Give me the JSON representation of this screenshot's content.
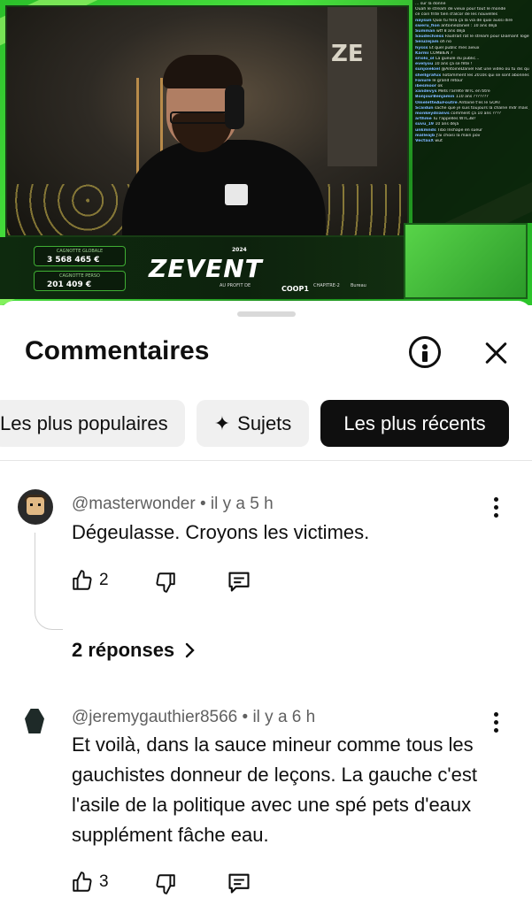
{
  "video": {
    "chat_messages": [
      {
        "user": "",
        "text": "... sur la donne"
      },
      {
        "user": "",
        "text": "Ouah le stream de vieux pour tout le monde"
      },
      {
        "user": "",
        "text": "ce coin frite tien d'alcor de les nouvelles"
      },
      {
        "user": "naysun",
        "text": "Quoi tu fera ça la via de quoi aussi dire"
      },
      {
        "user": "sweru_fion",
        "text": "antoineDaniel : 10 ans déjà"
      },
      {
        "user": "Summan",
        "text": "wtf 8 ans déjà"
      },
      {
        "user": "Saudechiess",
        "text": "Faudrait rat le stream pour Diamant Together"
      },
      {
        "user": "Seiuzejam",
        "text": "oh no"
      },
      {
        "user": "hysss",
        "text": "Et quel public mes aïeux"
      },
      {
        "user": "Karmi",
        "text": "COMBIEN ?"
      },
      {
        "user": "sriolo_ol",
        "text": "La gueule du public..."
      },
      {
        "user": "evelyou",
        "text": "10 ans ça se fête !"
      },
      {
        "user": "sunjoiekiel",
        "text": "@AntoineDaniel Fait une vidéo où tu dis que tu fais une pause Youtube"
      },
      {
        "user": "shellgrafux",
        "text": "notamment les 2010s qui se sont abonnés dans l'année précédente"
      },
      {
        "user": "Fanure",
        "text": "le grand retour"
      },
      {
        "user": "ibesmoor",
        "text": "ok"
      },
      {
        "user": "xandevys",
        "text": "Mets l'arrête WTC en titre"
      },
      {
        "user": "BonjourBenjamin",
        "text": "110 ans ???????"
      },
      {
        "user": "OmeletteAuFoutre",
        "text": "Antoine t'es le GOAT"
      },
      {
        "user": "Scaidun",
        "text": "sache que je suis toujours la chaîne mdr mais juste pour la nostalgie"
      },
      {
        "user": "monkeydiianvs",
        "text": "comment ça 10 ans ????"
      },
      {
        "user": "arthme",
        "text": "Tu l'appelles WTC38?"
      },
      {
        "user": "suvu_19",
        "text": "10 ans déjà"
      },
      {
        "user": "unkmnds",
        "text": "Tibo Inshape en sueur"
      },
      {
        "user": "malleajb",
        "text": "J'ai choisi la main pov"
      },
      {
        "user": "VectaxX",
        "text": "wut"
      }
    ],
    "cagnotte_globale_label": "CAGNOTTE GLOBALE",
    "cagnotte_globale_value": "3 568 465 €",
    "cagnotte_perso_label": "CAGNOTTE PERSO",
    "cagnotte_perso_value": "201 409 €",
    "event_logo": "ZEVENT",
    "event_year": "2024",
    "partner_prefix": "AU PROFIT DE",
    "partner_coop": "COOP1",
    "partner_chapitre": "CHAPITRE-2",
    "partner_bureau": "Bureau"
  },
  "sheet": {
    "title": "Commentaires",
    "info_icon": "info-circle-icon",
    "close_icon": "close-icon"
  },
  "filters": [
    {
      "label": "Les plus populaires",
      "active": false
    },
    {
      "label": "Sujets",
      "active": false,
      "icon": "sparkle-icon"
    },
    {
      "label": "Les plus récents",
      "active": true
    }
  ],
  "comments": [
    {
      "handle": "@masterwonder",
      "time": "il y a 5 h",
      "text": "Dégeulasse. Croyons les victimes.",
      "likes": "2",
      "replies_label": "2 réponses"
    },
    {
      "handle": "@jeremygauthier8566",
      "time": "il y a 6 h",
      "text": "Et voilà, dans la sauce mineur comme tous les gauchistes donneur de leçons. La gauche c'est l'asile de la politique avec une spé pets d'eaux supplément fâche eau.",
      "likes": "3"
    }
  ],
  "colors": {
    "active_chip_bg": "#0f0f0f",
    "chip_bg": "#f0f0f0",
    "meta_text": "#606060",
    "brand_green": "#49e23e"
  }
}
